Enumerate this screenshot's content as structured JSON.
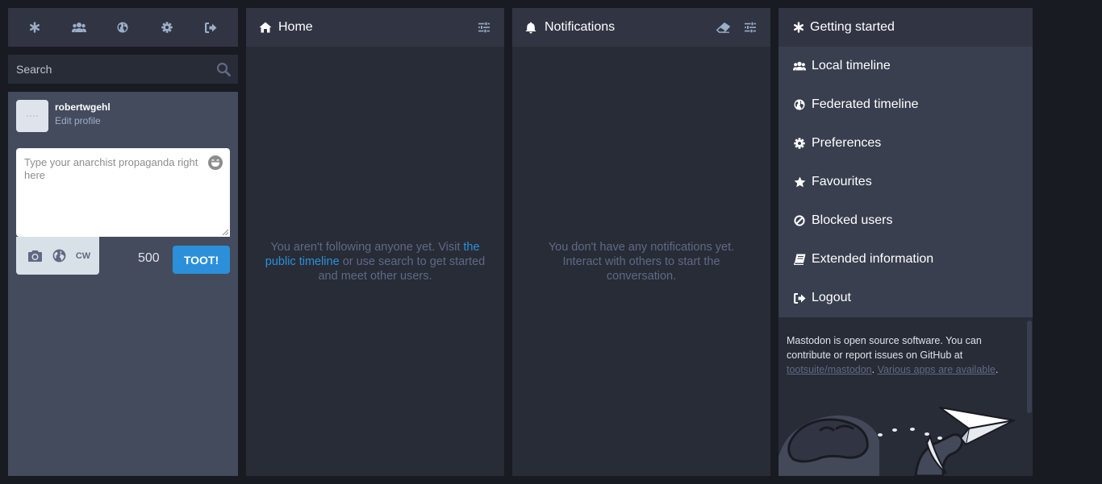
{
  "drawer": {
    "search": {
      "placeholder": "Search"
    },
    "account": {
      "username": "robertwgehl",
      "edit_profile": "Edit profile"
    },
    "compose": {
      "placeholder": "Type your anarchist propaganda right here",
      "cw_label": "CW",
      "char_count": "500",
      "toot_label": "TOOT!"
    }
  },
  "home": {
    "title": "Home",
    "empty_before": "You aren't following anyone yet. Visit ",
    "empty_link": "the public timeline",
    "empty_after": " or use search to get started and meet other users."
  },
  "notifications": {
    "title": "Notifications",
    "empty": "You don't have any notifications yet. Interact with others to start the conversation."
  },
  "getting_started": {
    "title": "Getting started",
    "items": [
      {
        "label": "Local timeline",
        "icon": "users-icon"
      },
      {
        "label": "Federated timeline",
        "icon": "globe-icon"
      },
      {
        "label": "Preferences",
        "icon": "gear-icon"
      },
      {
        "label": "Favourites",
        "icon": "star-icon"
      },
      {
        "label": "Blocked users",
        "icon": "ban-icon"
      },
      {
        "label": "Extended information",
        "icon": "book-icon"
      },
      {
        "label": "Logout",
        "icon": "sign-out-icon"
      }
    ],
    "footer": {
      "text_before": "Mastodon is open source software. You can contribute or report issues on GitHub at ",
      "repo_link": "tootsuite/mastodon",
      "sep": ". ",
      "apps_link": "Various apps are available",
      "end": "."
    }
  },
  "colors": {
    "background": "#191b22",
    "column": "#282c37",
    "header": "#313543",
    "drawer": "#444b5d",
    "accent": "#2b90d9",
    "muted": "#606984"
  }
}
